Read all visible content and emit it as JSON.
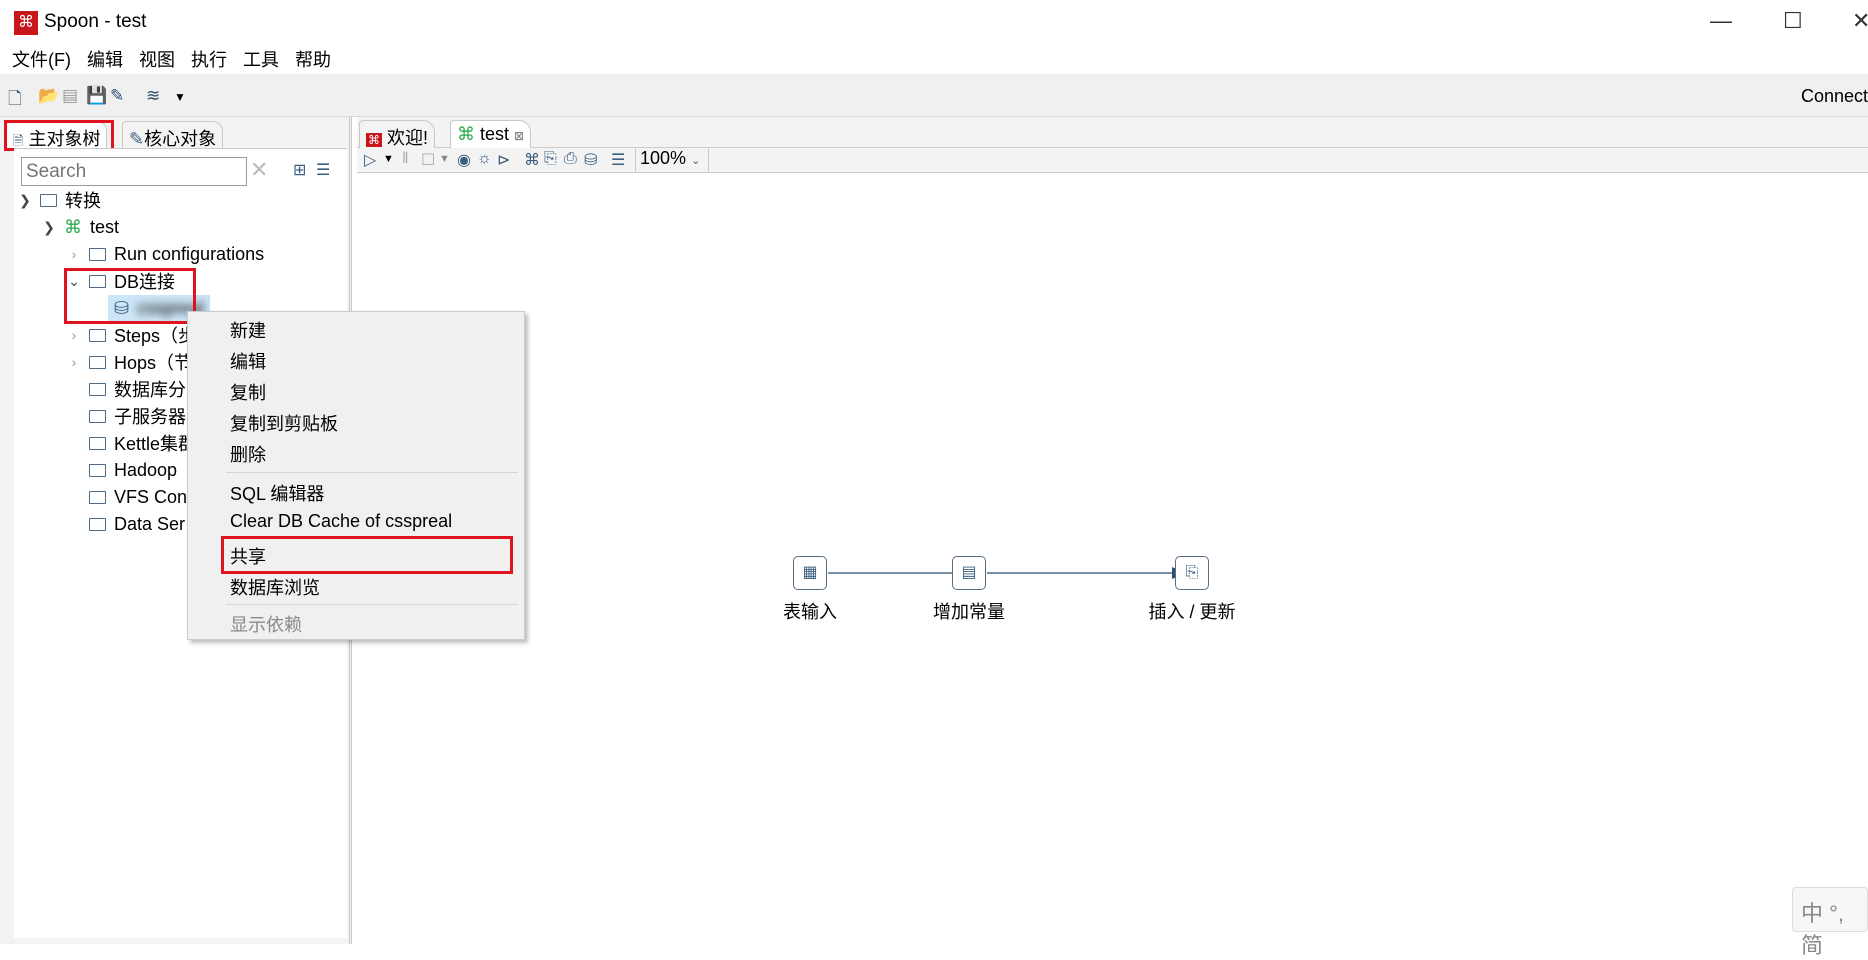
{
  "window": {
    "title": "Spoon - test",
    "minimize": "—",
    "maximize": "☐",
    "close": "✕"
  },
  "menu": [
    "文件(F)",
    "编辑",
    "视图",
    "执行",
    "工具",
    "帮助"
  ],
  "toolbar": {
    "connect": "Connect"
  },
  "left_panel": {
    "tabs": [
      "主对象树",
      "核心对象"
    ],
    "search_placeholder": "Search",
    "tree": [
      {
        "label": "转换",
        "level": 0,
        "expanded": true
      },
      {
        "label": "test",
        "level": 1,
        "expanded": true
      },
      {
        "label": "Run configurations",
        "level": 2,
        "expanded": false
      },
      {
        "label": "DB连接",
        "level": 2,
        "expanded": true
      },
      {
        "label": "csspreal",
        "level": 3,
        "selected": true
      },
      {
        "label": "Steps（步",
        "level": 2,
        "expanded": false
      },
      {
        "label": "Hops（节",
        "level": 2,
        "expanded": false
      },
      {
        "label": "数据库分",
        "level": 2
      },
      {
        "label": "子服务器",
        "level": 2
      },
      {
        "label": "Kettle集群",
        "level": 2
      },
      {
        "label": "Hadoop",
        "level": 2
      },
      {
        "label": "VFS Con",
        "level": 2
      },
      {
        "label": "Data Ser",
        "level": 2
      }
    ]
  },
  "editor": {
    "tabs": [
      "欢迎!",
      "test"
    ],
    "zoom": "100%",
    "steps": [
      "表输入",
      "增加常量",
      "插入 / 更新"
    ]
  },
  "context_menu": {
    "items": [
      "新建",
      "编辑",
      "复制",
      "复制到剪贴板",
      "删除",
      "SQL 编辑器",
      "Clear DB Cache of csspreal",
      "共享",
      "数据库浏览",
      "显示依赖"
    ]
  },
  "ime": "中 °, 简",
  "colors": {
    "highlight": "#e0141e",
    "accent": "#3a5f80",
    "brand": "#c8161d"
  }
}
